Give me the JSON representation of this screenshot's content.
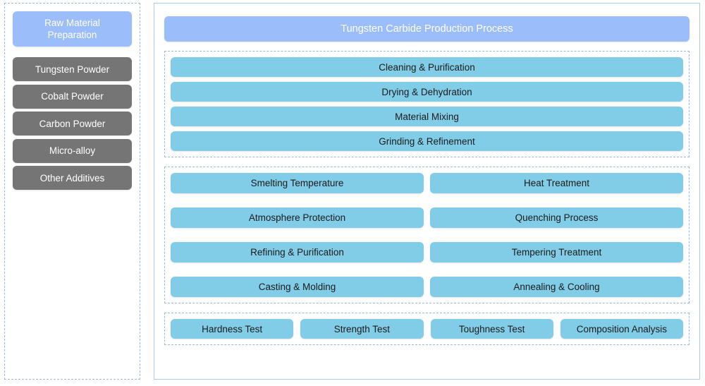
{
  "colors": {
    "accent_blue": "#9bbdf9",
    "chip_blue": "#81cde8",
    "material_gray": "#757575",
    "dashed_border": "#9ab8dd",
    "panel_border": "#a9cbe8"
  },
  "left_panel": {
    "header": {
      "label": "Raw Material\nPreparation",
      "line1": "Raw Material",
      "line2": "Preparation"
    },
    "materials": [
      {
        "label": "Tungsten Powder"
      },
      {
        "label": "Cobalt Powder"
      },
      {
        "label": "Carbon Powder"
      },
      {
        "label": "Micro-alloy"
      },
      {
        "label": "Other Additives"
      }
    ]
  },
  "right_panel": {
    "banner": {
      "title": "Tungsten Carbide Production Process"
    },
    "groups": [
      {
        "name": "preprocessing",
        "layout": "stack",
        "items": [
          {
            "label": "Cleaning & Purification"
          },
          {
            "label": "Drying & Dehydration"
          },
          {
            "label": "Material Mixing"
          },
          {
            "label": "Grinding & Refinement"
          }
        ]
      },
      {
        "name": "thermal-processing",
        "layout": "two-column",
        "items": [
          {
            "label": "Smelting Temperature"
          },
          {
            "label": "Heat Treatment"
          },
          {
            "label": "Atmosphere Protection"
          },
          {
            "label": "Quenching Process"
          },
          {
            "label": "Refining & Purification"
          },
          {
            "label": "Tempering Treatment"
          },
          {
            "label": "Casting & Molding"
          },
          {
            "label": "Annealing & Cooling"
          }
        ]
      },
      {
        "name": "quality-testing",
        "layout": "four-column",
        "items": [
          {
            "label": "Hardness Test"
          },
          {
            "label": "Strength Test"
          },
          {
            "label": "Toughness Test"
          },
          {
            "label": "Composition Analysis"
          }
        ]
      }
    ]
  }
}
